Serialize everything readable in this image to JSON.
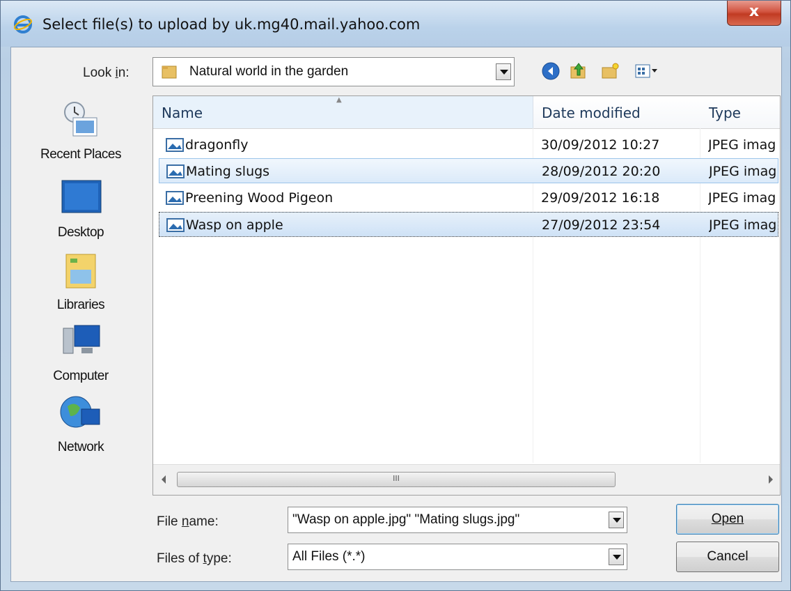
{
  "window": {
    "title": "Select file(s) to upload by uk.mg40.mail.yahoo.com",
    "close_label": "x"
  },
  "lookin": {
    "label": "Look in:",
    "value": "Natural world in the garden"
  },
  "toolbar": [
    "back-icon",
    "up-folder-icon",
    "new-folder-icon",
    "view-menu-icon"
  ],
  "sidebar": {
    "items": [
      {
        "label": "Recent Places",
        "icon": "recent-places-icon"
      },
      {
        "label": "Desktop",
        "icon": "desktop-icon"
      },
      {
        "label": "Libraries",
        "icon": "libraries-icon"
      },
      {
        "label": "Computer",
        "icon": "computer-icon"
      },
      {
        "label": "Network",
        "icon": "network-icon"
      }
    ]
  },
  "filelist": {
    "columns": [
      "Name",
      "Date modified",
      "Type"
    ],
    "rows": [
      {
        "name": "dragonfly",
        "date": "30/09/2012 10:27",
        "type": "JPEG imag"
      },
      {
        "name": "Mating slugs",
        "date": "28/09/2012 20:20",
        "type": "JPEG imag"
      },
      {
        "name": "Preening Wood Pigeon",
        "date": "29/09/2012 16:18",
        "type": "JPEG imag"
      },
      {
        "name": "Wasp on apple",
        "date": "27/09/2012 23:54",
        "type": "JPEG imag"
      }
    ],
    "scroll_grip": "III"
  },
  "form": {
    "filename_label": "File name:",
    "filename_value": "\"Wasp on apple.jpg\" \"Mating slugs.jpg\"",
    "filetype_label": "Files of type:",
    "filetype_value": "All Files (*.*)"
  },
  "buttons": {
    "open": "Open",
    "cancel": "Cancel"
  },
  "colors": {
    "selection": "#cfe2f6",
    "title_gradient": "#bad2ea",
    "close_red": "#c13b23"
  }
}
